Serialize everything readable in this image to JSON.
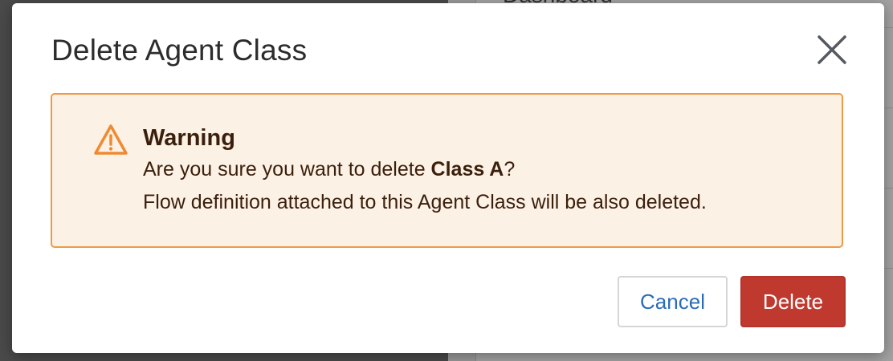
{
  "background": {
    "heading": "Dashboard"
  },
  "dialog": {
    "title": "Delete Agent Class",
    "close_icon": "close-icon"
  },
  "alert": {
    "icon": "warning-triangle-icon",
    "heading": "Warning",
    "line1_prefix": "Are you sure you want to delete ",
    "class_name": "Class A",
    "line1_suffix": "?",
    "line2": "Flow definition attached to this Agent Class will be also deleted."
  },
  "buttons": {
    "cancel_label": "Cancel",
    "delete_label": "Delete"
  },
  "colors": {
    "alert_background": "#fcf1e5",
    "alert_border": "#ef9a48",
    "warning_icon": "#ef8a32",
    "cancel_text": "#2b6cb8",
    "delete_background": "#c0392f"
  }
}
